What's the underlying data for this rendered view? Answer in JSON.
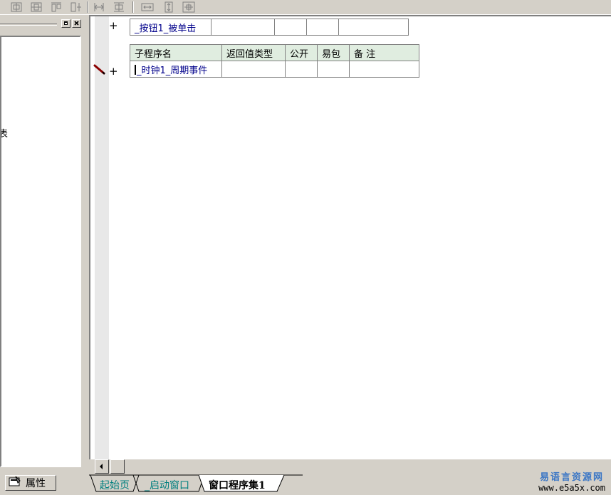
{
  "toolbar": {
    "icons": [
      "align-left-icon",
      "align-center-icon",
      "align-top-icon",
      "align-middle-icon",
      "same-width-icon",
      "same-height-icon",
      "hspace-icon",
      "vspace-icon",
      "center-both-icon"
    ]
  },
  "left_panel": {
    "partial_text": "表"
  },
  "property_tab": {
    "label": "属性"
  },
  "editor": {
    "event_row": {
      "marker": "+",
      "name": "_按钮1_被单击"
    },
    "sub_table": {
      "marker": "+",
      "headers": [
        "子程序名",
        "返回值类型",
        "公开",
        "易包",
        "备 注"
      ],
      "rows": [
        [
          "_时钟1_周期事件",
          "",
          "",
          "",
          ""
        ]
      ]
    }
  },
  "tabs": [
    {
      "label": "起始页",
      "active": false
    },
    {
      "label": "_启动窗口",
      "active": false
    },
    {
      "label": "窗口程序集1",
      "active": true
    }
  ],
  "watermark": {
    "title": "易语言资源网",
    "url": "www.e5a5x.com"
  },
  "colors": {
    "chrome": "#d4d0c8",
    "table_header": "#e0ede0",
    "link_blue": "#00008b",
    "tab_teal": "#007f7f",
    "watermark_blue": "#3a76c5",
    "pencil_red": "#8b0000"
  }
}
